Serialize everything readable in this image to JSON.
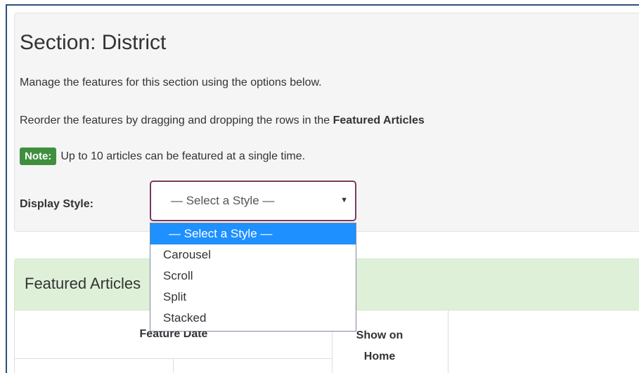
{
  "section": {
    "title": "Section: District",
    "intro": "Manage the features for this section using the options below.",
    "reorder_prefix": "Reorder the features by dragging and dropping the rows in the ",
    "reorder_bold": "Featured Articles",
    "note_badge": "Note:",
    "note_text": "Up to 10 articles can be featured at a single time."
  },
  "display_style": {
    "label": "Display Style:",
    "selected": "— Select a Style —",
    "options": [
      "— Select a Style —",
      "Carousel",
      "Scroll",
      "Split",
      "Stacked"
    ]
  },
  "featured": {
    "title": "Featured Articles",
    "columns": {
      "feature_date": "Feature Date",
      "show_on_home": "Show on Home"
    }
  },
  "colors": {
    "note_badge": "#3f8f3f",
    "panel_heading": "#dff0d8",
    "selected_option": "#1e90ff",
    "select_border": "#7b3b5b"
  }
}
